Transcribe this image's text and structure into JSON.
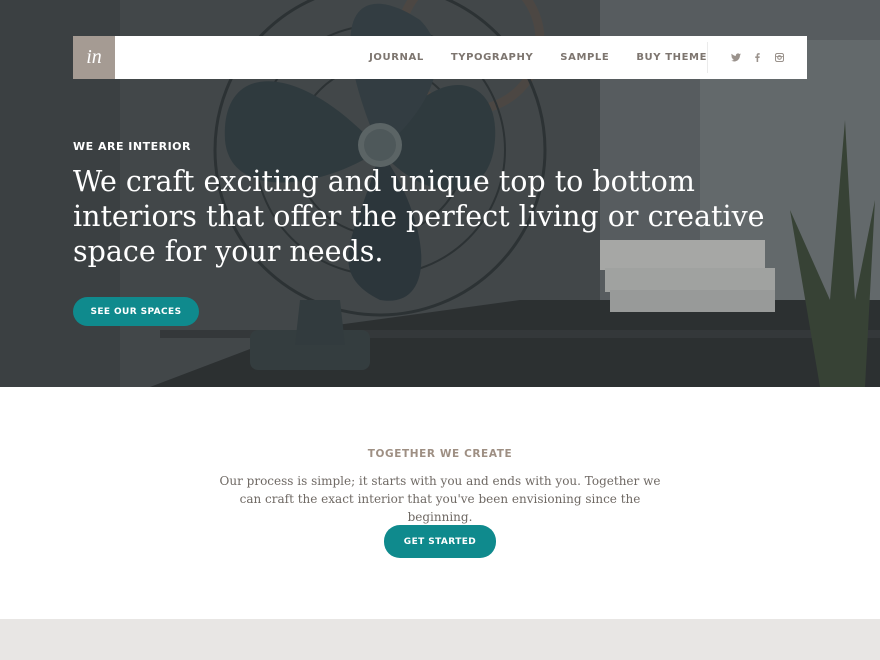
{
  "brand": {
    "logo_text": "in"
  },
  "nav": {
    "items": [
      {
        "label": "JOURNAL"
      },
      {
        "label": "TYPOGRAPHY"
      },
      {
        "label": "SAMPLE"
      },
      {
        "label": "BUY THEME"
      }
    ],
    "socials": [
      "twitter-icon",
      "facebook-icon",
      "instagram-icon"
    ]
  },
  "hero": {
    "kicker": "WE ARE INTERIOR",
    "headline": "We craft exciting and unique top to bottom interiors that offer the perfect living or creative space for your needs.",
    "button_label": "SEE OUR SPACES"
  },
  "intro": {
    "title": "TOGETHER WE CREATE",
    "text": "Our process is simple; it starts with you and ends with you. Together we can craft the exact interior that you've been envisioning since the beginning.",
    "button_label": "GET STARTED"
  },
  "colors": {
    "accent": "#0f8a8d",
    "logo_bg": "#a59b93",
    "nav_text": "#7d756f",
    "section_title": "#9e8f83",
    "footer_strip": "#e8e6e4"
  }
}
